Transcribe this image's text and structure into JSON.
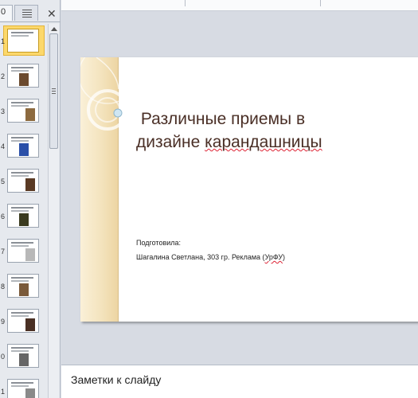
{
  "side_pane": {
    "slides_tab_label": "0",
    "close_label": "✕",
    "thumbnails": [
      {
        "number": "1",
        "selected": true
      },
      {
        "number": "2",
        "selected": false
      },
      {
        "number": "3",
        "selected": false
      },
      {
        "number": "4",
        "selected": false
      },
      {
        "number": "5",
        "selected": false
      },
      {
        "number": "6",
        "selected": false
      },
      {
        "number": "7",
        "selected": false
      },
      {
        "number": "8",
        "selected": false
      },
      {
        "number": "9",
        "selected": false
      },
      {
        "number": "0",
        "selected": false
      },
      {
        "number": "1",
        "selected": false
      }
    ]
  },
  "slide": {
    "title_line1": "Различные приемы в",
    "title_line2_a": "дизайне ",
    "title_line2_b": "карандашницы",
    "author_label": "Подготовила:",
    "author_line_a": "Шагалина Светлана, 303 гр. Реклама (",
    "author_line_b": "УрФУ",
    "author_line_c": ")"
  },
  "notes": {
    "placeholder": "Заметки к слайду"
  },
  "colors": {
    "selected_thumb": "#fcd86b",
    "title_text": "#4a2f26",
    "deco_band": "#f3e2bb"
  }
}
